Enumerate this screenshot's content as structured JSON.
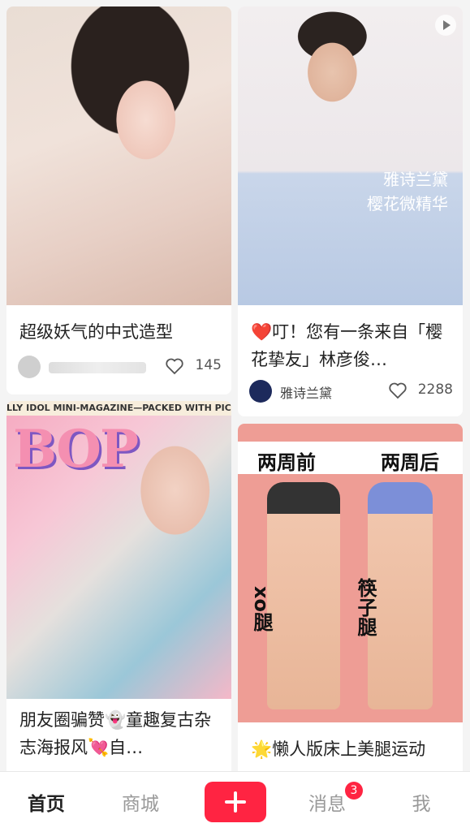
{
  "feed": {
    "cards": [
      {
        "title": "超级妖气的中式造型",
        "author": "",
        "likes": "145",
        "image_icon": "chinese-style-makeup-photo"
      },
      {
        "title": "❤️叮！您有一条来自「樱花挚友」林彦俊…",
        "overlay_text": "雅诗兰黛\n樱花微精华",
        "author": "雅诗兰黛",
        "likes": "2288",
        "image_icon": "product-video-thumbnail"
      },
      {
        "title": "朋友圈骗赞👻童趣复古杂志海报风💘自…",
        "overlay_text": "LLY IDOL MINI-MAGAZINE—PACKED WITH PICS",
        "image_icon": "retro-magazine-collage"
      },
      {
        "title": "🌟懒人版床上美腿运动",
        "label_left": "两周前",
        "label_right": "两周后",
        "side_left": "xo腿",
        "side_right": "筷子腿",
        "image_icon": "leg-comparison-photo"
      }
    ]
  },
  "tabbar": {
    "home": "首页",
    "mall": "商城",
    "messages": "消息",
    "messages_badge": "3",
    "me": "我"
  },
  "colors": {
    "brand": "#ff2442",
    "active_tab": "#222222",
    "inactive_tab": "#999999"
  }
}
